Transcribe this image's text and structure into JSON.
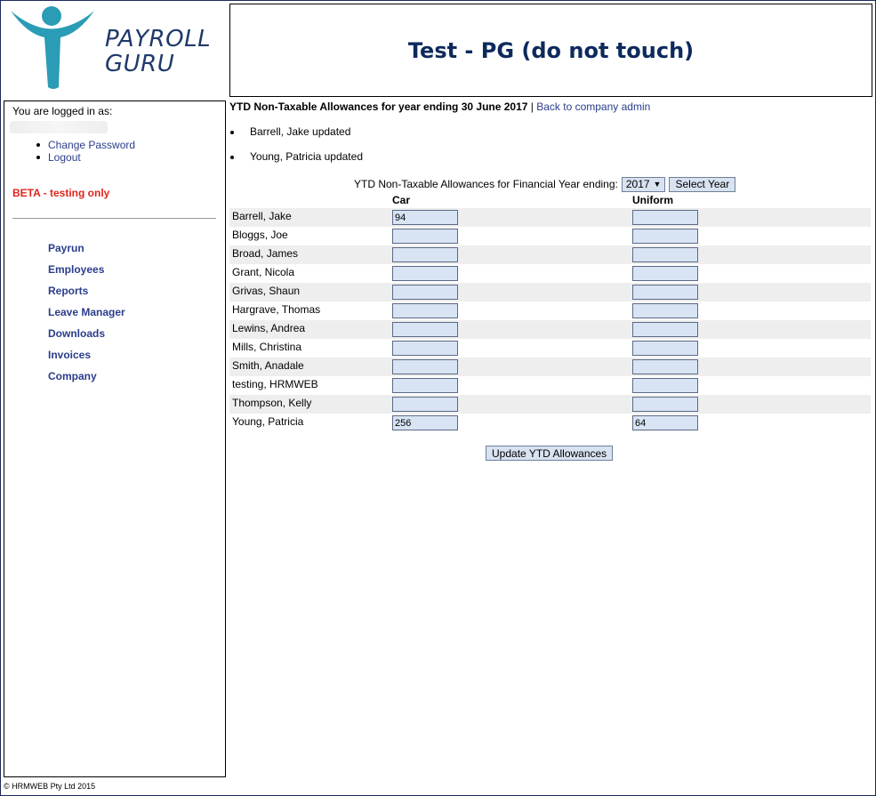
{
  "logo": {
    "line1": "PAYROLL",
    "line2": "GURU"
  },
  "header": {
    "title": "Test - PG (do not touch)"
  },
  "sidebar": {
    "logged_in_label": "You are logged in as:",
    "user_links": [
      {
        "label": "Change Password"
      },
      {
        "label": "Logout"
      }
    ],
    "beta": "BETA - testing only",
    "nav": [
      {
        "label": "Payrun"
      },
      {
        "label": "Employees"
      },
      {
        "label": "Reports"
      },
      {
        "label": "Leave Manager"
      },
      {
        "label": "Downloads"
      },
      {
        "label": "Invoices"
      },
      {
        "label": "Company"
      }
    ]
  },
  "main": {
    "title": "YTD Non-Taxable Allowances for year ending 30 June 2017",
    "separator": " | ",
    "back_link": "Back to company admin",
    "messages": [
      "Barrell, Jake updated",
      "Young, Patricia updated"
    ],
    "year_label": "YTD Non-Taxable Allowances for Financial Year ending:",
    "year_value": "2017",
    "select_year_button": "Select Year",
    "columns": {
      "car": "Car",
      "uniform": "Uniform"
    },
    "rows": [
      {
        "name": "Barrell, Jake",
        "car": "94",
        "uniform": ""
      },
      {
        "name": "Bloggs, Joe",
        "car": "",
        "uniform": ""
      },
      {
        "name": "Broad, James",
        "car": "",
        "uniform": ""
      },
      {
        "name": "Grant, Nicola",
        "car": "",
        "uniform": ""
      },
      {
        "name": "Grivas, Shaun",
        "car": "",
        "uniform": ""
      },
      {
        "name": "Hargrave, Thomas",
        "car": "",
        "uniform": ""
      },
      {
        "name": "Lewins, Andrea",
        "car": "",
        "uniform": ""
      },
      {
        "name": "Mills, Christina",
        "car": "",
        "uniform": ""
      },
      {
        "name": "Smith, Anadale",
        "car": "",
        "uniform": ""
      },
      {
        "name": "testing, HRMWEB",
        "car": "",
        "uniform": ""
      },
      {
        "name": "Thompson, Kelly",
        "car": "",
        "uniform": ""
      },
      {
        "name": "Young, Patricia",
        "car": "256",
        "uniform": "64"
      }
    ],
    "update_button": "Update YTD Allowances"
  },
  "footer": {
    "text": "© HRMWEB Pty Ltd 2015"
  },
  "colors": {
    "brand_blue": "#0d2a5c",
    "link": "#2b3d8c",
    "beta_red": "#e0251b",
    "logo_teal": "#2b9cb5"
  }
}
